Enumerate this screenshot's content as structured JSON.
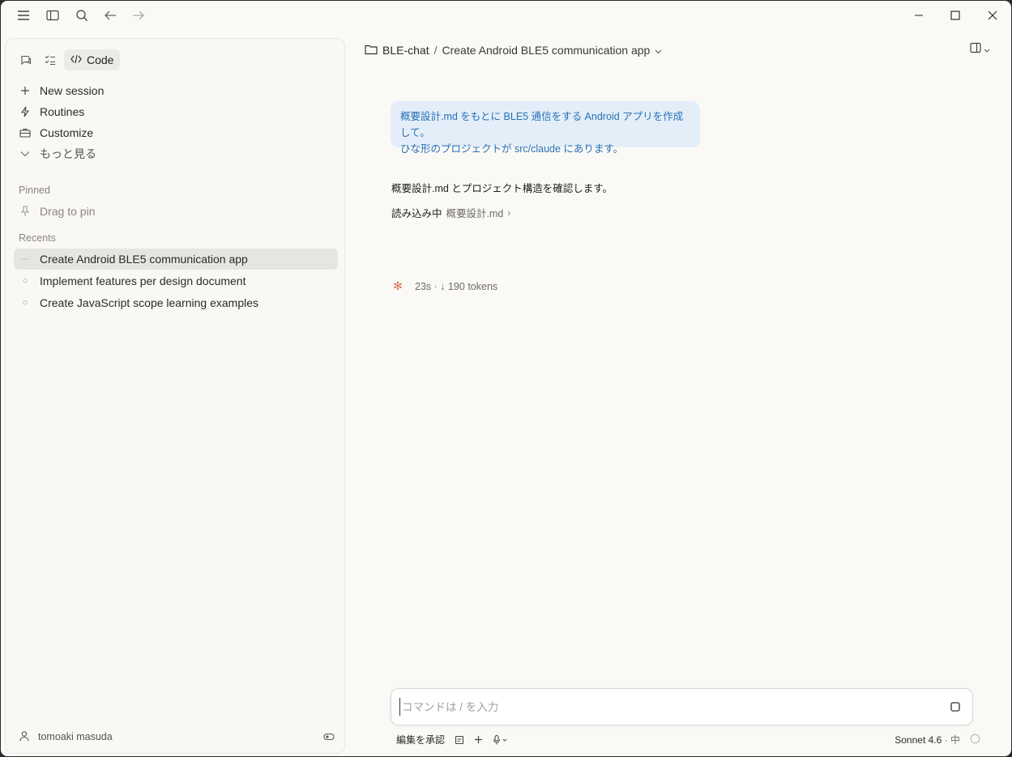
{
  "breadcrumb": {
    "folder": "BLE-chat",
    "separator": "/",
    "title": "Create Android BLE5 communication app"
  },
  "sidebar": {
    "mode_code_label": "Code",
    "nav": [
      {
        "label": "New session",
        "icon": "plus-icon"
      },
      {
        "label": "Routines",
        "icon": "bolt-icon"
      },
      {
        "label": "Customize",
        "icon": "briefcase-icon"
      },
      {
        "label": "もっと見る",
        "icon": "chevron-down-icon"
      }
    ],
    "pinned_label": "Pinned",
    "drag_to_pin": "Drag to pin",
    "recents_label": "Recents",
    "recents": [
      {
        "label": "Create Android BLE5 communication app",
        "marker": "···",
        "active": true
      },
      {
        "label": "Implement features per design document",
        "marker": "○",
        "active": false
      },
      {
        "label": "Create JavaScript scope learning examples",
        "marker": "○",
        "active": false
      }
    ],
    "user_name": "tomoaki masuda"
  },
  "chat": {
    "user_message_line1": "概要設計.md をもとに BLE5 通信をする Android アプリを作成して。",
    "user_message_line2": "ひな形のプロジェクトが src/claude にあります。",
    "assistant_text": "概要設計.md とプロジェクト構造を確認します。",
    "reading_status": "読み込み中",
    "reading_file": "概要設計.md",
    "reading_chevron": "›",
    "stats": "23s · ↓ 190 tokens"
  },
  "composer": {
    "placeholder": "コマンドは / を入力",
    "value": ""
  },
  "footer": {
    "accept_edits": "編集を承認",
    "model": "Sonnet 4.6",
    "effort": "· 中"
  },
  "colors": {
    "bubble_bg": "#e3eef8",
    "bubble_text": "#2a6fb4",
    "spark": "#d9734f",
    "active_recent": "#e6e5e0"
  }
}
